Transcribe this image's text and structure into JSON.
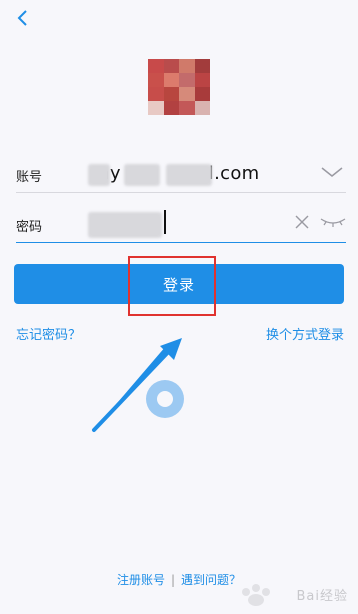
{
  "header": {
    "back_icon": "chevron-left-icon"
  },
  "avatar": {
    "colors": [
      "#c84a4a",
      "#b94c4c",
      "#d07a6a",
      "#a23c3c",
      "#c9504b",
      "#dc7b6c",
      "#c36b6b",
      "#bb4444",
      "#c74d4a",
      "#b8463f",
      "#d68a7a",
      "#a83b3b",
      "#e8c9c4",
      "#b24141",
      "#c35858",
      "#d9b3b0"
    ]
  },
  "account": {
    "label": "账号",
    "value_suffix": "l.com",
    "value_prefix": "my"
  },
  "password": {
    "label": "密码"
  },
  "login": {
    "button_label": "登录"
  },
  "links": {
    "forgot": "忘记密码？",
    "switch": "换个方式登录"
  },
  "footer": {
    "register": "注册账号",
    "separator": "|",
    "help": "遇到问题？"
  },
  "watermark": {
    "text": "Bai经验"
  },
  "colors": {
    "accent": "#1f8ee6",
    "highlight_box": "#e0322f"
  }
}
